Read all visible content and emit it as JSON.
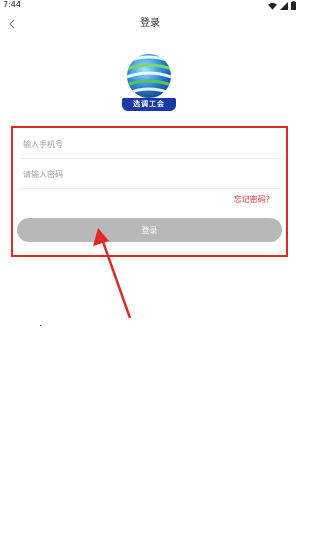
{
  "status_bar": {
    "time": "7:44"
  },
  "nav": {
    "title": "登录",
    "back_icon": "chevron-left-icon"
  },
  "logo": {
    "text": "选调工会"
  },
  "form": {
    "phone_placeholder": "输入手机号",
    "password_placeholder": "请输入密码",
    "forgot_label": "忘记密码?",
    "login_label": "登录"
  },
  "colors": {
    "highlight": "#e02a2a",
    "button_bg": "#b8b8b8",
    "logo_label_bg": "#1a3aa8"
  }
}
